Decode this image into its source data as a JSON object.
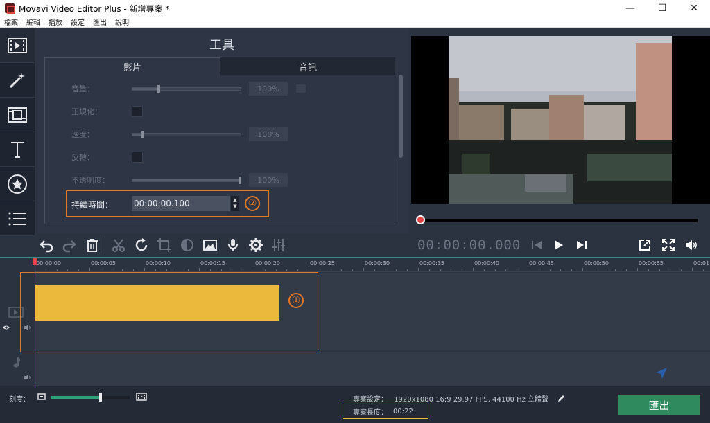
{
  "window": {
    "title": "Movavi Video Editor Plus - 新增專案 *",
    "minimize": "—",
    "maximize": "☐",
    "close": "✕"
  },
  "menu": {
    "items": [
      "檔案",
      "編輯",
      "播放",
      "設定",
      "匯出",
      "說明"
    ]
  },
  "sidebar": {
    "items": [
      {
        "icon": "film-import-icon"
      },
      {
        "icon": "magic-wand-icon"
      },
      {
        "icon": "transitions-icon"
      },
      {
        "icon": "title-text-icon"
      },
      {
        "icon": "sticker-star-icon"
      },
      {
        "icon": "list-icon"
      }
    ]
  },
  "tools": {
    "title": "工具",
    "tabs": [
      "影片",
      "音訊"
    ],
    "properties": [
      {
        "label": "音量：",
        "value": "100%",
        "slider": 0.25
      },
      {
        "label": "正規化：",
        "type": "checkbox"
      },
      {
        "label": "速度：",
        "value": "100%",
        "slider": 0.1
      },
      {
        "label": "反轉：",
        "type": "checkbox"
      },
      {
        "label": "不透明度：",
        "value": "100%",
        "slider": 1.0
      }
    ],
    "duration": {
      "label": "持續時間：",
      "value": "00:00:00.100",
      "spin_up": "▲",
      "spin_down": "▼",
      "marker": "②"
    }
  },
  "player": {
    "timecode": "00:00:00.000",
    "progress": 0
  },
  "timeline": {
    "ticks": [
      "00:00:00",
      "00:00:05",
      "00:00:10",
      "00:00:15",
      "00:00:20",
      "00:00:25",
      "00:00:30",
      "00:00:35",
      "00:00:40",
      "00:00:45",
      "00:00:50",
      "00:00:55",
      "00:01"
    ],
    "marker": "①"
  },
  "footer": {
    "zoom_label": "刻度：",
    "zoom_level": 0.63,
    "project_settings_label": "專案設定：",
    "project_settings_value": "1920x1080 16:9 29.97 FPS, 44100 Hz 立體聲",
    "project_length_label": "專案長度：",
    "project_length_value": "00:22",
    "export_label": "匯出"
  },
  "colors": {
    "accent": "#e87722",
    "clip": "#ebb93c",
    "export": "#2f8a5e",
    "playhead": "#e04444"
  }
}
